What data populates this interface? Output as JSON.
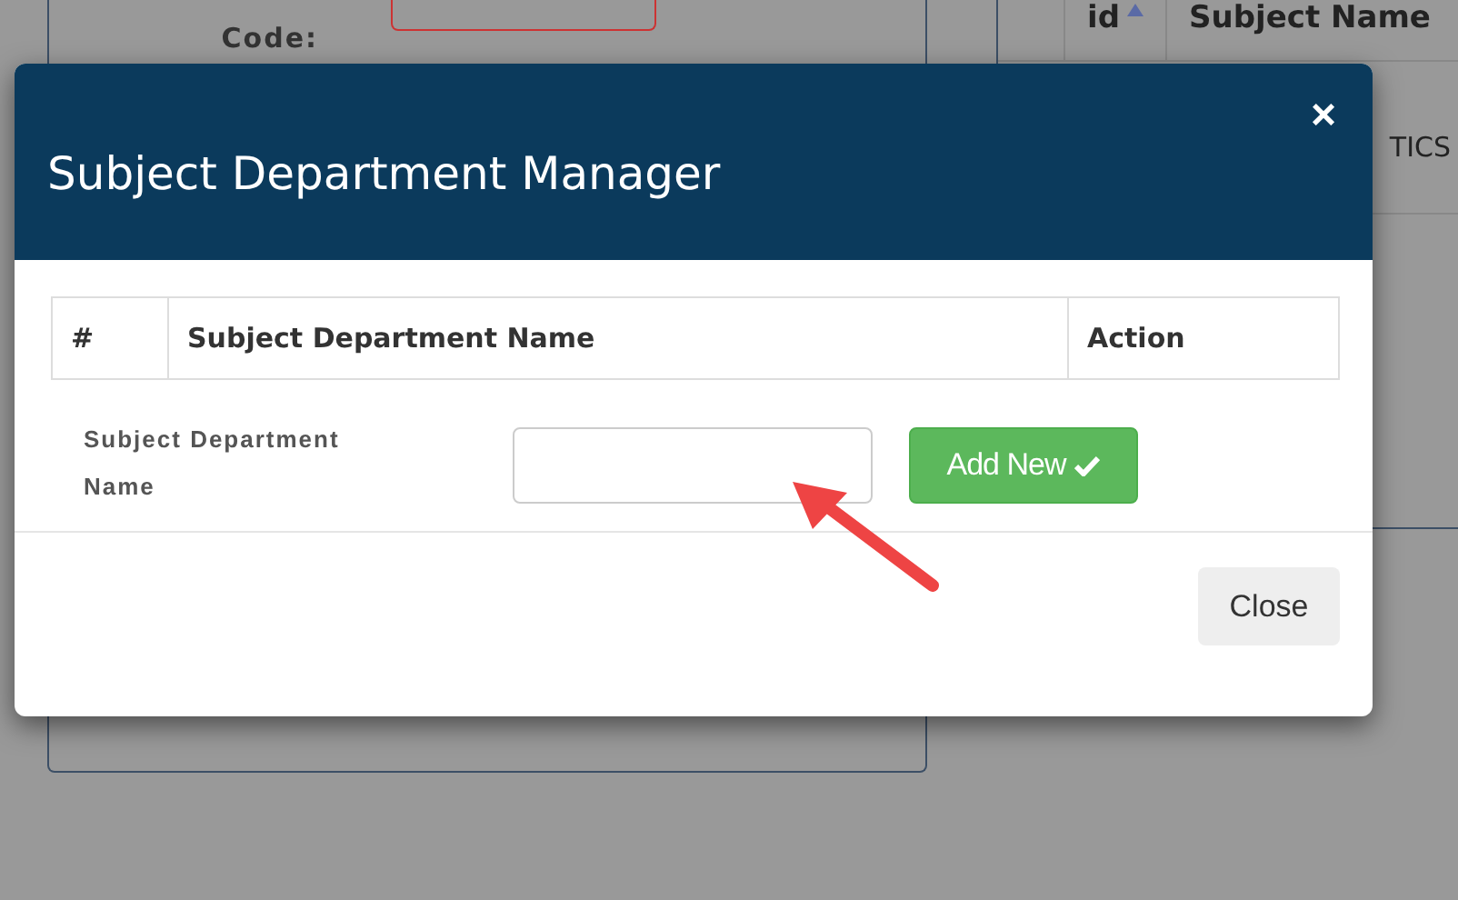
{
  "background": {
    "form_label": "Code:",
    "table_columns": [
      {
        "label": "id",
        "sorted": true
      },
      {
        "label": "Subject Name",
        "sorted": false
      }
    ],
    "cell": "TICS"
  },
  "modal": {
    "title": "Subject Department Manager",
    "close": "×",
    "table": {
      "columns": [
        "#",
        "Subject Department Name",
        "Action"
      ]
    },
    "form": {
      "label": "Subject Department Name",
      "add_button": "Add New"
    },
    "footer_button": "Close"
  }
}
